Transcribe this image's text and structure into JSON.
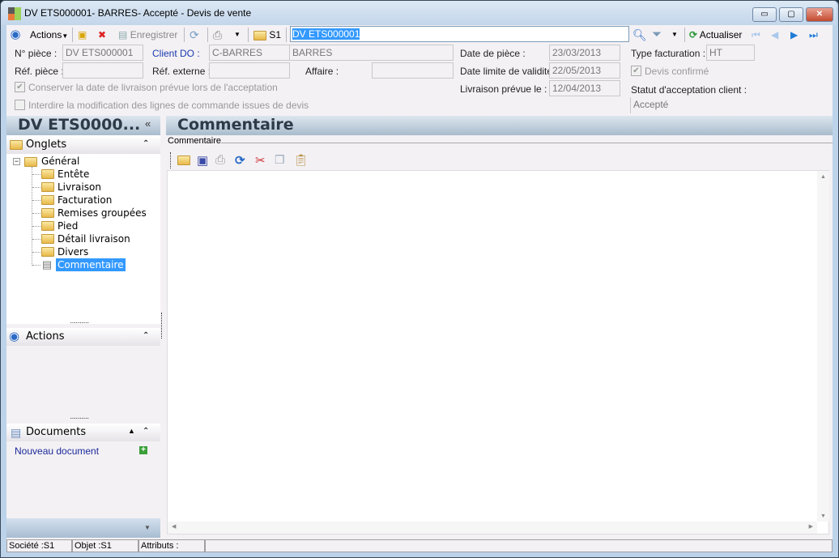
{
  "window": {
    "title": "DV ETS000001- BARRES- Accepté -  Devis de vente",
    "minimize": "▭",
    "maximize": "▢",
    "close": "✕"
  },
  "toolbar": {
    "actions": "Actions",
    "save": "Enregistrer",
    "s1": "S1",
    "search_value": "DV ETS000001",
    "refresh": "Actualiser"
  },
  "form": {
    "n_piece_label": "N° pièce :",
    "n_piece": "DV ETS000001",
    "client_label": "Client DO :",
    "client_code": "C-BARRES",
    "client_name": "BARRES",
    "ref_piece_label": "Réf. pièce :",
    "ref_piece": "",
    "ref_externe_label": "Réf. externe :",
    "ref_externe": "",
    "affaire_label": "Affaire :",
    "affaire": "",
    "date_piece_label": "Date de pièce :",
    "date_piece": "23/03/2013",
    "date_limite_label": "Date limite de validité :",
    "date_limite": "22/05/2013",
    "livraison_label": "Livraison prévue le :",
    "livraison": "12/04/2013",
    "type_fact_label": "Type facturation :",
    "type_fact": "HT",
    "devis_confirme": "Devis confirmé",
    "statut_label": "Statut d'acceptation client :",
    "statut": "Accepté",
    "conserver": "Conserver la date de livraison prévue lors de l'acceptation",
    "interdire": "Interdire la modification des lignes de commande issues de devis"
  },
  "sidebar": {
    "title": "DV ETS0000...",
    "collapse": "«",
    "onglets": "Onglets",
    "tree_root": "Général",
    "tree_items": [
      "Entête",
      "Livraison",
      "Facturation",
      "Remises groupées",
      "Pied",
      "Détail livraison",
      "Divers",
      "Commentaire"
    ],
    "actions": "Actions",
    "documents": "Documents",
    "new_document": "Nouveau document"
  },
  "main": {
    "title": "Commentaire",
    "group_label": "Commentaire"
  },
  "statusbar": {
    "societe": "Société :S1",
    "objet": "Objet :S1",
    "attributs": "Attributs :"
  }
}
